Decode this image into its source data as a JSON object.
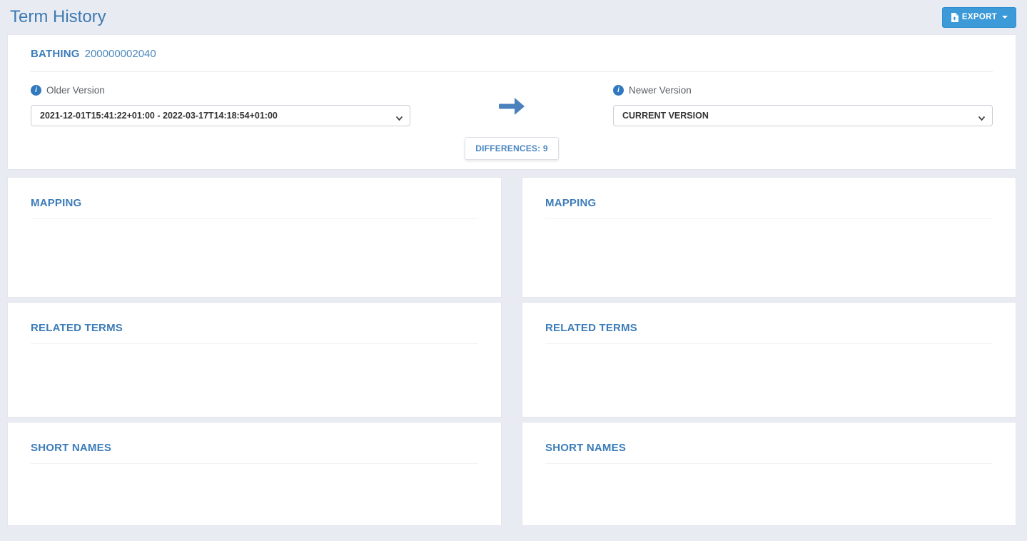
{
  "header": {
    "title": "Term History",
    "export_label": "EXPORT"
  },
  "term": {
    "name": "BATHING",
    "id": "200000002040"
  },
  "comparison": {
    "older_label": "Older Version",
    "older_value": "2021-12-01T15:41:22+01:00 - 2022-03-17T14:18:54+01:00",
    "newer_label": "Newer Version",
    "newer_value": "CURRENT VERSION",
    "differences_label": "DIFFERENCES: 9"
  },
  "icons": {
    "info_glyph": "i"
  },
  "sections": {
    "left": [
      {
        "title": "MAPPING"
      },
      {
        "title": "RELATED TERMS"
      },
      {
        "title": "SHORT NAMES"
      }
    ],
    "right": [
      {
        "title": "MAPPING"
      },
      {
        "title": "RELATED TERMS"
      },
      {
        "title": "SHORT NAMES"
      }
    ]
  },
  "colors": {
    "page_background": "#e9ebf2",
    "heading_blue": "#3c7cb8",
    "export_button_blue": "#3d9ad8",
    "arrow_blue": "#4a82bd",
    "info_icon_blue": "#3178be"
  }
}
